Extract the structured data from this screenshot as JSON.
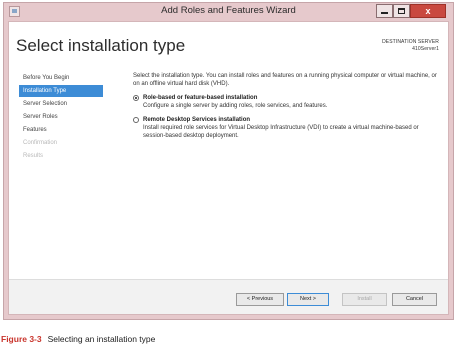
{
  "window": {
    "title": "Add Roles and Features Wizard",
    "controls": {
      "minimize_icon": "minimize-icon",
      "maximize_icon": "maximize-icon",
      "close_label": "x"
    }
  },
  "page": {
    "heading": "Select installation type",
    "destination": {
      "label": "DESTINATION SERVER",
      "server": "410Server1"
    }
  },
  "nav": {
    "items": [
      {
        "label": "Before You Begin",
        "state": "normal"
      },
      {
        "label": "Installation Type",
        "state": "active"
      },
      {
        "label": "Server Selection",
        "state": "normal"
      },
      {
        "label": "Server Roles",
        "state": "normal"
      },
      {
        "label": "Features",
        "state": "normal"
      },
      {
        "label": "Confirmation",
        "state": "disabled"
      },
      {
        "label": "Results",
        "state": "disabled"
      }
    ]
  },
  "content": {
    "intro": "Select the installation type. You can install roles and features on a running physical computer or virtual machine, or on an offline virtual hard disk (VHD).",
    "options": [
      {
        "title": "Role-based or feature-based installation",
        "description": "Configure a single server by adding roles, role services, and features.",
        "selected": true
      },
      {
        "title": "Remote Desktop Services installation",
        "description": "Install required role services for Virtual Desktop Infrastructure (VDI) to create a virtual machine-based or session-based desktop deployment.",
        "selected": false
      }
    ]
  },
  "footer": {
    "previous": "< Previous",
    "next": "Next >",
    "install": "Install",
    "cancel": "Cancel"
  },
  "caption": {
    "figure": "Figure 3-3",
    "text": "Selecting an installation type"
  },
  "colors": {
    "accent": "#3d8cd6",
    "frame": "#e6c9cc",
    "close": "#c9483f",
    "caption_red": "#c9352d"
  }
}
